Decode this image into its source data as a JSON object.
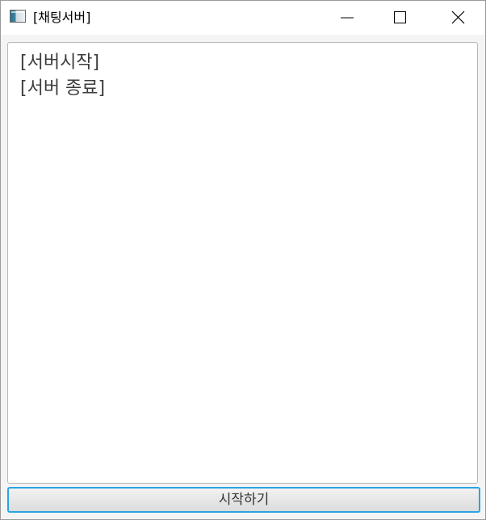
{
  "window": {
    "title": "[채팅서버]",
    "icon": "app-window-icon",
    "controls": {
      "minimize_icon": "minimize-icon",
      "maximize_icon": "maximize-icon",
      "close_icon": "close-icon"
    }
  },
  "log": {
    "lines": [
      "[서버시작]",
      "[서버 종료]"
    ]
  },
  "footer": {
    "start_label": "시작하기",
    "accent_color": "#2aa3e3"
  }
}
